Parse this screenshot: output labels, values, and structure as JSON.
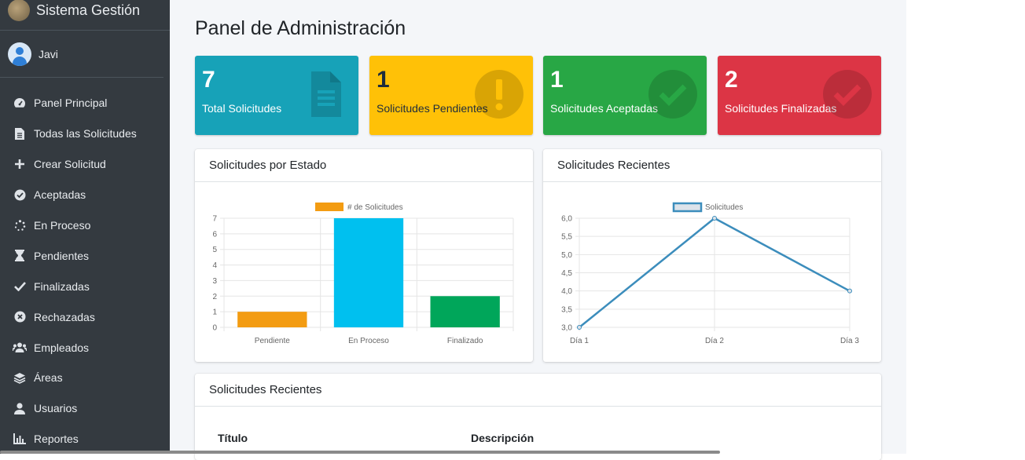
{
  "brand": {
    "title": "Sistema Gestión"
  },
  "user": {
    "name": "Javi"
  },
  "sidebar": {
    "items": [
      {
        "label": "Panel Principal",
        "icon": "dashboard-icon"
      },
      {
        "label": "Todas las Solicitudes",
        "icon": "file-icon"
      },
      {
        "label": "Crear Solicitud",
        "icon": "plus-icon"
      },
      {
        "label": "Aceptadas",
        "icon": "check-circle-icon"
      },
      {
        "label": "En Proceso",
        "icon": "spinner-icon"
      },
      {
        "label": "Pendientes",
        "icon": "hourglass-icon"
      },
      {
        "label": "Finalizadas",
        "icon": "check-icon"
      },
      {
        "label": "Rechazadas",
        "icon": "times-circle-icon"
      },
      {
        "label": "Empleados",
        "icon": "users-icon"
      },
      {
        "label": "Áreas",
        "icon": "layers-icon"
      },
      {
        "label": "Usuarios",
        "icon": "user-icon"
      },
      {
        "label": "Reportes",
        "icon": "bar-chart-icon"
      }
    ]
  },
  "page": {
    "title": "Panel de Administración"
  },
  "stats": [
    {
      "value": "7",
      "label": "Total Solicitudes",
      "color": "#17a2b8",
      "icon": "file-icon"
    },
    {
      "value": "1",
      "label": "Solicitudes Pendientes",
      "color": "#ffc107",
      "icon": "exclamation-icon"
    },
    {
      "value": "1",
      "label": "Solicitudes Aceptadas",
      "color": "#28a745",
      "icon": "check-circle-icon"
    },
    {
      "value": "2",
      "label": "Solicitudes Finalizadas",
      "color": "#dc3545",
      "icon": "check-circle-icon"
    }
  ],
  "cards": {
    "status_title": "Solicitudes por Estado",
    "recent_chart_title": "Solicitudes Recientes",
    "recent_table_title": "Solicitudes Recientes"
  },
  "table": {
    "headers": [
      "Título",
      "Descripción"
    ]
  },
  "chart_data": [
    {
      "type": "bar",
      "categories": [
        "Pendiente",
        "En Proceso",
        "Finalizado"
      ],
      "series": [
        {
          "name": "# de Solicitudes",
          "values": [
            1,
            7,
            2
          ]
        }
      ],
      "colors": [
        "#f39c12",
        "#00c0ef",
        "#00a65a"
      ],
      "ylim": [
        0,
        7
      ],
      "yticks": [
        "0",
        "1",
        "2",
        "3",
        "4",
        "5",
        "6",
        "7"
      ],
      "grid": true,
      "legend": "top"
    },
    {
      "type": "line",
      "categories": [
        "Día 1",
        "Día 2",
        "Día 3"
      ],
      "series": [
        {
          "name": "Solicitudes",
          "values": [
            3,
            6,
            4
          ]
        }
      ],
      "ylim": [
        3,
        6
      ],
      "yticks": [
        "3,0",
        "3,5",
        "4,0",
        "4,5",
        "5,0",
        "5,5",
        "6,0"
      ],
      "line_color": "#3c8dbc",
      "grid": true,
      "legend": "top"
    }
  ]
}
